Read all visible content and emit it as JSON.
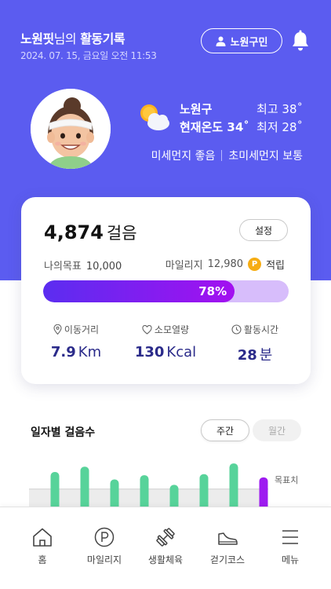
{
  "header": {
    "user_name": "노원핏",
    "user_suffix": "님의",
    "title_rest": " 활동기록",
    "datetime": "2024. 07. 15, 금요일 오전 11:53",
    "member_button": "노원구민"
  },
  "weather": {
    "region": "노원구",
    "current": "현재온도 34˚",
    "high": "최고 38˚",
    "low": "최저 28˚",
    "fine_dust": "미세먼지 좋음",
    "ultra_fine_dust": "초미세먼지 보통"
  },
  "activity": {
    "steps": "4,874",
    "steps_unit": "걸음",
    "settings_button": "설정",
    "goal_label": "나의목표",
    "goal_value": "10,000",
    "mileage_label": "마일리지",
    "mileage_value": "12,980",
    "mileage_coin": "P",
    "mileage_earn": "적립",
    "progress_percent": 78,
    "progress_label": "78%",
    "distance_label": "이동거리",
    "distance_value": "7.9",
    "distance_unit": "Km",
    "calories_label": "소모열량",
    "calories_value": "130",
    "calories_unit": "Kcal",
    "time_label": "활동시간",
    "time_value": "28",
    "time_unit": "분"
  },
  "daily": {
    "title": "일자별 걸음수",
    "tab_weekly": "주간",
    "tab_monthly": "월간",
    "goal_line_label": "목표치"
  },
  "chart_data": {
    "type": "bar",
    "values": [
      0.72,
      0.82,
      0.58,
      0.66,
      0.48,
      0.68,
      0.88,
      0.62
    ],
    "highlight_last": true,
    "goal_level": 0.4,
    "colors": {
      "bar": "#57d39a",
      "bar_top": "#4ec58c",
      "today": "#9e1cf0",
      "goal_band": "#ececec"
    }
  },
  "nav": {
    "items": [
      {
        "label": "홈",
        "icon": "home-icon"
      },
      {
        "label": "마일리지",
        "icon": "mileage-p-icon"
      },
      {
        "label": "생활체육",
        "icon": "dumbbell-icon"
      },
      {
        "label": "걷기코스",
        "icon": "shoe-icon"
      },
      {
        "label": "메뉴",
        "icon": "hamburger-menu-icon"
      }
    ]
  },
  "colors": {
    "primary": "#5b5cf0",
    "accent_purple": "#a310f0",
    "value_text": "#2b2b8a",
    "coin": "#f6ad14"
  }
}
